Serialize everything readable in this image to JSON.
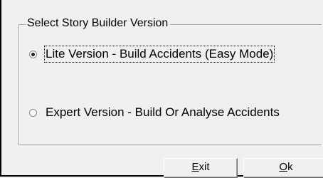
{
  "dialog": {
    "group_title": "Select Story Builder Version",
    "options": [
      {
        "label": "Lite Version - Build Accidents (Easy Mode)",
        "checked": true
      },
      {
        "label": "Expert Version - Build Or Analyse Accidents",
        "checked": false
      }
    ],
    "buttons": {
      "exit": {
        "mnemonic": "E",
        "rest": "xit"
      },
      "ok": {
        "mnemonic": "O",
        "rest": "k"
      }
    }
  }
}
